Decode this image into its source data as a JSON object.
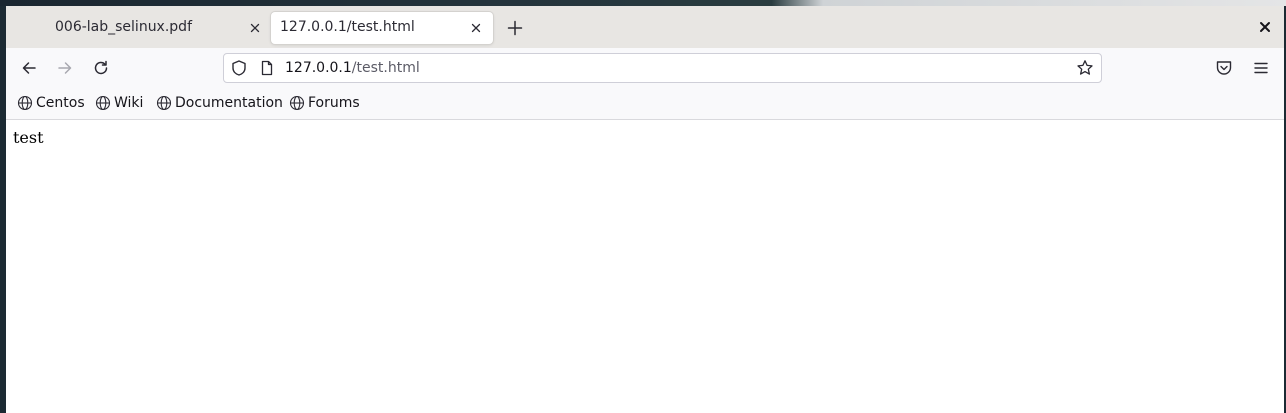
{
  "tabs": [
    {
      "title": "006-lab_selinux.pdf",
      "active": false
    },
    {
      "title": "127.0.0.1/test.html",
      "active": true
    }
  ],
  "urlbar": {
    "host": "127.0.0.1",
    "path": "/test.html"
  },
  "bookmarks": [
    {
      "label": "Centos"
    },
    {
      "label": "Wiki"
    },
    {
      "label": "Documentation"
    },
    {
      "label": "Forums"
    }
  ],
  "page": {
    "body_text": "test"
  },
  "colors": {
    "tabstrip_bg": "#e8e6e3",
    "toolbar_bg": "#f9f9fb",
    "active_tab_bg": "#ffffff",
    "icon": "#2b2a33",
    "icon_disabled": "#a8a8b0"
  }
}
